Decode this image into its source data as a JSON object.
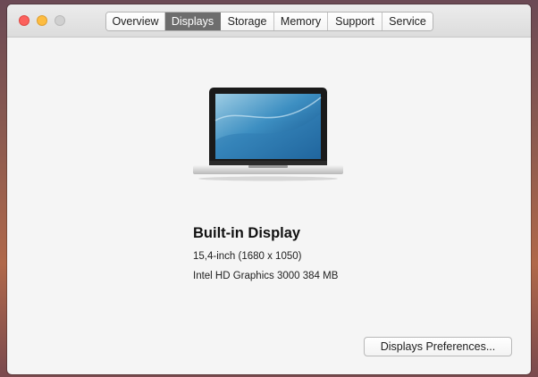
{
  "window": {
    "tabs": [
      {
        "label": "Overview",
        "active": false
      },
      {
        "label": "Displays",
        "active": true
      },
      {
        "label": "Storage",
        "active": false
      },
      {
        "label": "Memory",
        "active": false
      },
      {
        "label": "Support",
        "active": false
      },
      {
        "label": "Service",
        "active": false
      }
    ]
  },
  "display": {
    "name": "Built-in Display",
    "size_resolution": "15,4-inch (1680 x 1050)",
    "graphics": "Intel HD Graphics 3000 384 MB",
    "icon": "macbook-pro-laptop-icon"
  },
  "actions": {
    "preferences_label": "Displays Preferences..."
  },
  "colors": {
    "close": "#fc615d",
    "minimize": "#fdbc40",
    "zoom_disabled": "#d0d0d0",
    "active_tab": "#6d6d6d"
  }
}
